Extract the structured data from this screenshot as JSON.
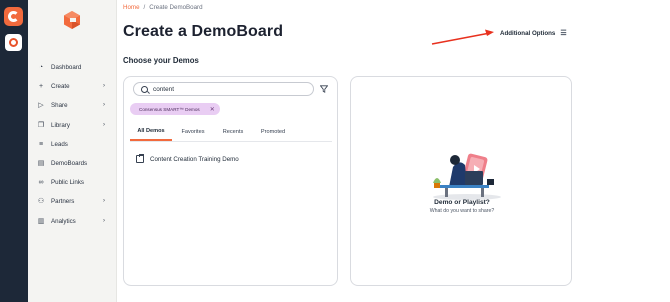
{
  "breadcrumb": {
    "home": "Home",
    "separator": "/",
    "current": "Create DemoBoard"
  },
  "page": {
    "title": "Create a DemoBoard",
    "additional_options": "Additional Options",
    "section_title": "Choose your Demos"
  },
  "sidebar": {
    "items": [
      {
        "label": "Dashboard",
        "icon": "dashboard-icon",
        "has_chevron": false
      },
      {
        "label": "Create",
        "icon": "plus-icon",
        "has_chevron": true
      },
      {
        "label": "Share",
        "icon": "share-icon",
        "has_chevron": true
      },
      {
        "label": "Library",
        "icon": "library-icon",
        "has_chevron": true
      },
      {
        "label": "Leads",
        "icon": "filter-lines-icon",
        "has_chevron": false
      },
      {
        "label": "DemoBoards",
        "icon": "board-icon",
        "has_chevron": false
      },
      {
        "label": "Public Links",
        "icon": "link-icon",
        "has_chevron": false
      },
      {
        "label": "Partners",
        "icon": "partners-icon",
        "has_chevron": true
      },
      {
        "label": "Analytics",
        "icon": "analytics-icon",
        "has_chevron": true
      }
    ]
  },
  "search": {
    "value": "content"
  },
  "chip": {
    "label": "Consensus SMART™ Demos"
  },
  "tabs": [
    "All Demos",
    "Favorites",
    "Recents",
    "Promoted"
  ],
  "demos": [
    {
      "label": "Content Creation Training Demo"
    }
  ],
  "empty_state": {
    "title": "Demo or Playlist?",
    "subtitle": "What do you want to share?"
  },
  "colors": {
    "accent": "#f26a3d",
    "rail": "#1d2838",
    "chip": "#e9cdf3",
    "arrow": "#e8311e"
  }
}
